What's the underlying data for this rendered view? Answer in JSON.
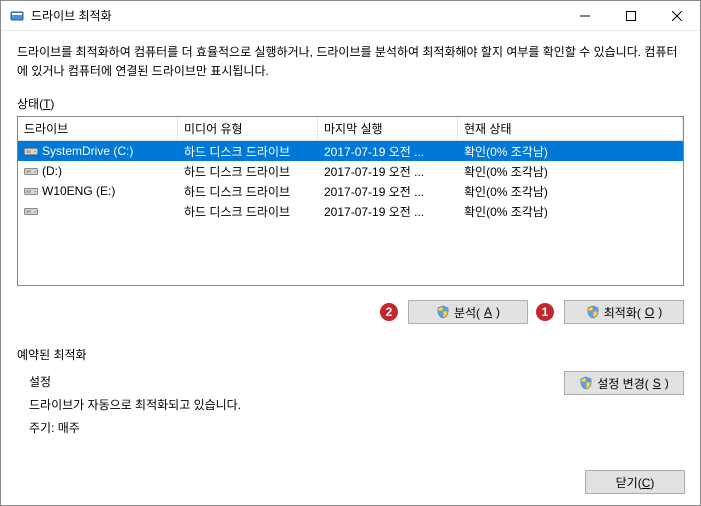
{
  "window": {
    "title": "드라이브 최적화"
  },
  "description": "드라이브를 최적화하여 컴퓨터를 더 효율적으로 실행하거나, 드라이브를 분석하여 최적화해야 할지 여부를 확인할 수 있습니다. 컴퓨터에 있거나 컴퓨터에 연결된 드라이브만 표시됩니다.",
  "status_label_pre": "상태(",
  "status_label_u": "T",
  "status_label_post": ")",
  "columns": {
    "drive": "드라이브",
    "media": "미디어 유형",
    "last": "마지막 실행",
    "state": "현재 상태"
  },
  "drives": [
    {
      "name": "SystemDrive (C:)",
      "media": "하드 디스크 드라이브",
      "last": "2017-07-19 오전 ...",
      "state": "확인(0% 조각남)",
      "icontype": "hdd",
      "selected": true
    },
    {
      "name": "(D:)",
      "media": "하드 디스크 드라이브",
      "last": "2017-07-19 오전 ...",
      "state": "확인(0% 조각남)",
      "icontype": "hdd",
      "selected": false
    },
    {
      "name": "W10ENG (E:)",
      "media": "하드 디스크 드라이브",
      "last": "2017-07-19 오전 ...",
      "state": "확인(0% 조각남)",
      "icontype": "hdd",
      "selected": false
    },
    {
      "name": "",
      "media": "하드 디스크 드라이브",
      "last": "2017-07-19 오전 ...",
      "state": "확인(0% 조각남)",
      "icontype": "hdd",
      "selected": false
    }
  ],
  "markers": {
    "analyze": "2",
    "optimize": "1"
  },
  "buttons": {
    "analyze_pre": "분석(",
    "analyze_u": "A",
    "analyze_post": ")",
    "optimize_pre": "최적화(",
    "optimize_u": "O",
    "optimize_post": ")",
    "settings_pre": "설정 변경(",
    "settings_u": "S",
    "settings_post": ")",
    "close_pre": "닫기(",
    "close_u": "C",
    "close_post": ")"
  },
  "schedule": {
    "header": "예약된 최적화",
    "title": "설정",
    "line1": "드라이브가 자동으로 최적화되고 있습니다.",
    "line2": "주기: 매주"
  }
}
